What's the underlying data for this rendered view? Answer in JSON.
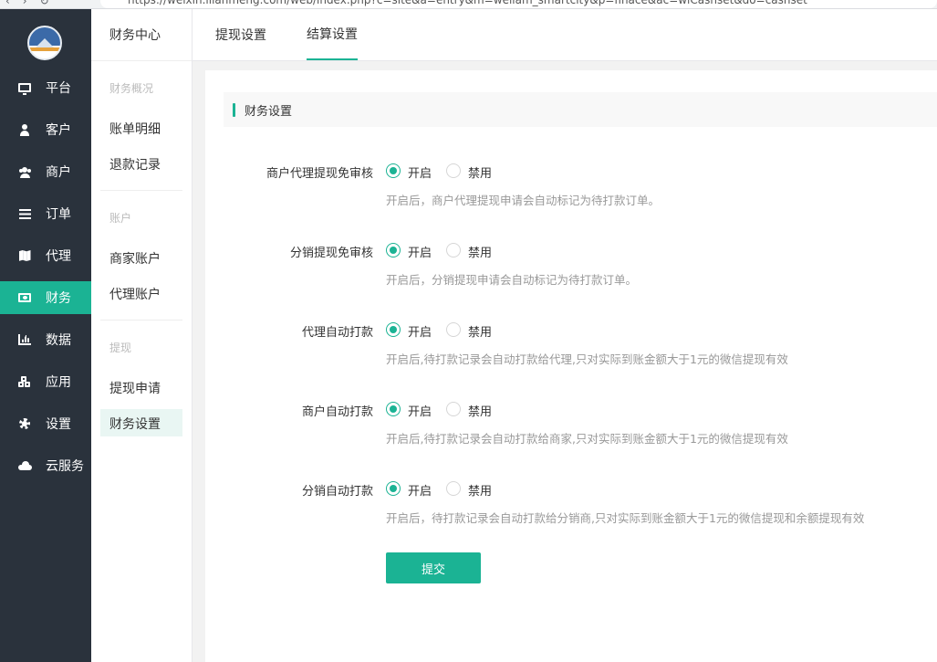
{
  "browser": {
    "url": "https://weixin.ilianmeng.com/web/index.php?c=site&a=entry&m=weliam_smartcity&p=finace&ac=wlCashset&do=cashset"
  },
  "sidebar": {
    "items": [
      {
        "label": "平台",
        "icon": "monitor-icon"
      },
      {
        "label": "客户",
        "icon": "user-icon"
      },
      {
        "label": "商户",
        "icon": "users-icon"
      },
      {
        "label": "订单",
        "icon": "list-icon"
      },
      {
        "label": "代理",
        "icon": "map-icon"
      },
      {
        "label": "财务",
        "icon": "money-icon",
        "active": true
      },
      {
        "label": "数据",
        "icon": "bar-chart-icon"
      },
      {
        "label": "应用",
        "icon": "cubes-icon"
      },
      {
        "label": "设置",
        "icon": "gear-icon"
      },
      {
        "label": "云服务",
        "icon": "cloud-icon"
      }
    ]
  },
  "subnav": {
    "title": "财务中心",
    "groups": [
      {
        "title": "财务概况",
        "links": [
          "账单明细",
          "退款记录"
        ]
      },
      {
        "title": "账户",
        "links": [
          "商家账户",
          "代理账户"
        ]
      },
      {
        "title": "提现",
        "links": [
          "提现申请",
          "财务设置"
        ]
      }
    ],
    "active": "财务设置"
  },
  "tabs": [
    {
      "label": "提现设置",
      "active": false
    },
    {
      "label": "结算设置",
      "active": true
    }
  ],
  "section": {
    "title": "财务设置"
  },
  "options": {
    "on": "开启",
    "off": "禁用"
  },
  "settings": [
    {
      "label": "商户代理提现免审核",
      "value": "开启",
      "hint": "开启后，商户代理提现申请会自动标记为待打款订单。"
    },
    {
      "label": "分销提现免审核",
      "value": "开启",
      "hint": "开启后，分销提现申请会自动标记为待打款订单。"
    },
    {
      "label": "代理自动打款",
      "value": "开启",
      "hint": "开启后,待打款记录会自动打款给代理,只对实际到账金额大于1元的微信提现有效"
    },
    {
      "label": "商户自动打款",
      "value": "开启",
      "hint": "开启后,待打款记录会自动打款给商家,只对实际到账金额大于1元的微信提现有效"
    },
    {
      "label": "分销自动打款",
      "value": "开启",
      "hint": "开启后，待打款记录会自动打款给分销商,只对实际到账金额大于1元的微信提现和余额提现有效"
    }
  ],
  "submit_label": "提交",
  "colors": {
    "accent": "#1bb394",
    "sidebar": "#2a323c"
  }
}
